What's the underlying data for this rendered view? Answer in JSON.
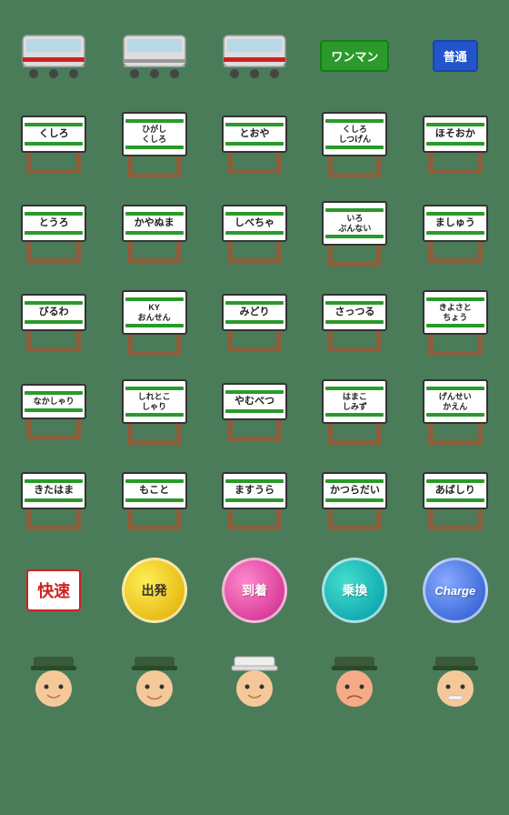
{
  "rows": [
    {
      "cells": [
        {
          "type": "train",
          "variant": "red-stripe"
        },
        {
          "type": "train",
          "variant": "gray"
        },
        {
          "type": "train",
          "variant": "red-stripe2"
        },
        {
          "type": "label",
          "text": "ワンマン",
          "color": "green"
        },
        {
          "type": "label",
          "text": "普通",
          "color": "blue"
        }
      ]
    },
    {
      "cells": [
        {
          "type": "station",
          "text": "くしろ"
        },
        {
          "type": "station",
          "text": "ひがし\nくしろ",
          "small": true
        },
        {
          "type": "station",
          "text": "とおや"
        },
        {
          "type": "station",
          "text": "くしろ\nしつげん",
          "small": true
        },
        {
          "type": "station",
          "text": "ほそおか"
        }
      ]
    },
    {
      "cells": [
        {
          "type": "station",
          "text": "とうろ"
        },
        {
          "type": "station",
          "text": "かやぬま"
        },
        {
          "type": "station",
          "text": "しべちゃ"
        },
        {
          "type": "station",
          "text": "いろ\nぶんない",
          "small": true
        },
        {
          "type": "station",
          "text": "ましゅう"
        }
      ]
    },
    {
      "cells": [
        {
          "type": "station",
          "text": "びるわ"
        },
        {
          "type": "station",
          "text": "KY\nおんせん",
          "small": true
        },
        {
          "type": "station",
          "text": "みどり"
        },
        {
          "type": "station",
          "text": "さっつる"
        },
        {
          "type": "station",
          "text": "きよさと\nちょう",
          "small": true
        }
      ]
    },
    {
      "cells": [
        {
          "type": "station",
          "text": "なかしゃり"
        },
        {
          "type": "station",
          "text": "しれとこ\nしゃり",
          "small": true
        },
        {
          "type": "station",
          "text": "やむべつ"
        },
        {
          "type": "station",
          "text": "はまこ\nしみず",
          "small": true
        },
        {
          "type": "station",
          "text": "げんせい\nかえん",
          "small": true
        }
      ]
    },
    {
      "cells": [
        {
          "type": "station",
          "text": "きたはま"
        },
        {
          "type": "station",
          "text": "もこと"
        },
        {
          "type": "station",
          "text": "ますうら"
        },
        {
          "type": "station",
          "text": "かつらだい"
        },
        {
          "type": "station",
          "text": "あばしり"
        }
      ]
    },
    {
      "cells": [
        {
          "type": "fast",
          "text": "快速"
        },
        {
          "type": "bubble",
          "text": "出発",
          "color": "yellow"
        },
        {
          "type": "bubble",
          "text": "到着",
          "color": "pink"
        },
        {
          "type": "bubble",
          "text": "乗換",
          "color": "teal"
        },
        {
          "type": "bubble",
          "text": "Charge",
          "color": "blue2",
          "italic": true
        }
      ]
    },
    {
      "cells": [
        {
          "type": "officer",
          "variant": "normal"
        },
        {
          "type": "officer",
          "variant": "happy"
        },
        {
          "type": "officer",
          "variant": "white-hat"
        },
        {
          "type": "officer",
          "variant": "angry"
        },
        {
          "type": "officer",
          "variant": "grin"
        }
      ]
    }
  ]
}
